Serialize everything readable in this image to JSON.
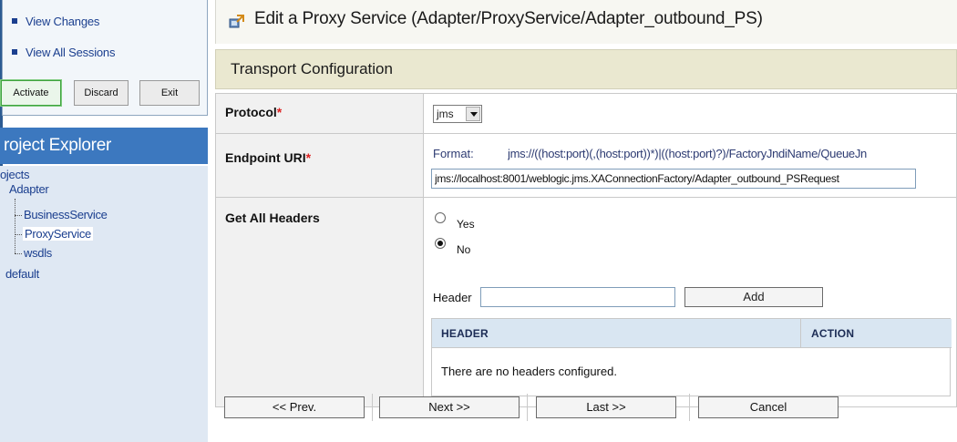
{
  "sidebar": {
    "change_center": {
      "links": [
        "View Changes",
        "View All Sessions"
      ],
      "buttons": {
        "activate": "Activate",
        "discard": "Discard",
        "exit": "Exit"
      }
    },
    "project_explorer": {
      "title": "roject Explorer",
      "tree": {
        "root": "ojects",
        "project": "Adapter",
        "children": [
          "BusinessService",
          "ProxyService",
          "wsdls"
        ],
        "selected": "ProxyService",
        "other": "default"
      }
    }
  },
  "main": {
    "page_title": "Edit a Proxy Service (Adapter/ProxyService/Adapter_outbound_PS)",
    "section_title": "Transport Configuration",
    "fields": {
      "protocol": {
        "label": "Protocol",
        "required_mark": "*",
        "value": "jms"
      },
      "endpoint_uri": {
        "label": "Endpoint URI",
        "required_mark": "*",
        "format_label": "Format:",
        "format_text": "jms://((host:port)(,(host:port))*)|((host:port)?)/FactoryJndiName/QueueJn",
        "value": "jms://localhost:8001/weblogic.jms.XAConnectionFactory/Adapter_outbound_PSRequest"
      },
      "get_all_headers": {
        "label": "Get All Headers",
        "options": [
          "Yes",
          "No"
        ],
        "selected": "No",
        "header_label": "Header",
        "header_value": "",
        "add_button": "Add",
        "table": {
          "columns": [
            "HEADER",
            "ACTION"
          ],
          "empty_message": "There are no headers configured."
        }
      }
    },
    "nav_buttons": {
      "prev": "<< Prev.",
      "next": "Next >>",
      "last": "Last >>",
      "cancel": "Cancel"
    }
  },
  "colors": {
    "accent_blue": "#3c78bf",
    "link_blue": "#1b3f8f",
    "required_red": "#dd2222",
    "section_bg": "#eae8d0",
    "tree_bg": "#dfe8f3"
  }
}
